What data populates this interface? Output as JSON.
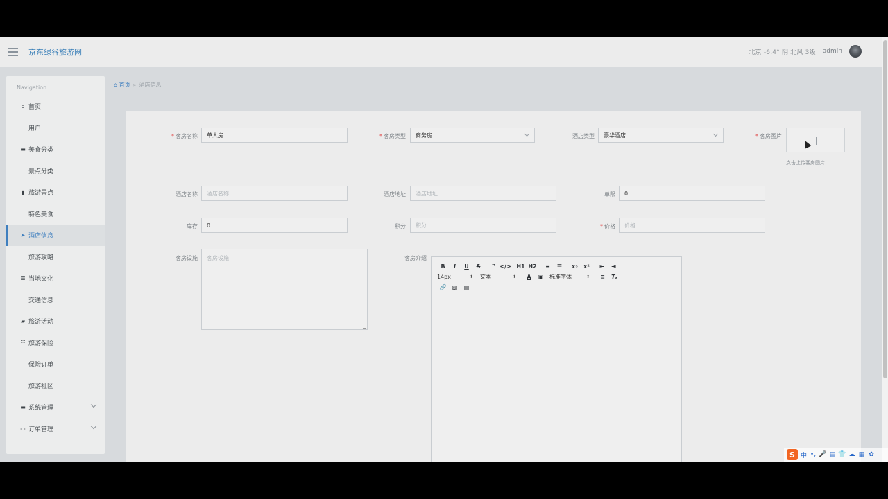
{
  "app": {
    "title": "京东绿谷旅游网"
  },
  "header": {
    "weather": "北京  -6.4°  阴  北风  3级",
    "user": "admin"
  },
  "sidebar": {
    "title": "Navigation",
    "items": [
      {
        "label": "首页",
        "icon": "home-icon"
      },
      {
        "label": "用户",
        "icon": "grid-icon"
      },
      {
        "label": "美食分类",
        "icon": "monitor-icon"
      },
      {
        "label": "景点分类",
        "icon": "grid-icon"
      },
      {
        "label": "旅游景点",
        "icon": "clipboard-icon"
      },
      {
        "label": "特色美食",
        "icon": "grid-icon"
      },
      {
        "label": "酒店信息",
        "icon": "send-icon",
        "active": true
      },
      {
        "label": "旅游攻略",
        "icon": "grid-icon"
      },
      {
        "label": "当地文化",
        "icon": "list-icon"
      },
      {
        "label": "交通信息",
        "icon": "grid-icon"
      },
      {
        "label": "旅游活动",
        "icon": "camera-icon"
      },
      {
        "label": "旅游保险",
        "icon": "sliders-icon"
      },
      {
        "label": "保险订单",
        "icon": "grid-icon"
      },
      {
        "label": "旅游社区",
        "icon": "grid-icon"
      },
      {
        "label": "系统管理",
        "icon": "monitor-icon",
        "expandable": true
      },
      {
        "label": "订单管理",
        "icon": "chat-icon",
        "expandable": true
      }
    ]
  },
  "breadcrumb": {
    "home": "首页",
    "separator": "»",
    "current": "酒店信息"
  },
  "form": {
    "room_name": {
      "label": "客房名称",
      "value": "单人房"
    },
    "room_type": {
      "label": "客房类型",
      "value": "商务房"
    },
    "hotel_type": {
      "label": "酒店类型",
      "value": "豪华酒店"
    },
    "room_image": {
      "label": "客房图片",
      "hint": "点击上传客房图片"
    },
    "hotel_name": {
      "label": "酒店名称",
      "placeholder": "酒店名称"
    },
    "hotel_address": {
      "label": "酒店地址",
      "placeholder": "酒店地址"
    },
    "limit": {
      "label": "单限",
      "value": "0"
    },
    "stock": {
      "label": "库存",
      "value": "0"
    },
    "points": {
      "label": "积分",
      "placeholder": "积分"
    },
    "price": {
      "label": "价格",
      "placeholder": "价格"
    },
    "facilities": {
      "label": "客房设施",
      "placeholder": "客房设施"
    },
    "intro": {
      "label": "客房介绍"
    }
  },
  "editor": {
    "row1": [
      "B",
      "I",
      "U",
      "S",
      "❞",
      "</>",
      "H1",
      "H2",
      "≡",
      "☰",
      "x₂",
      "x²",
      "⇤",
      "⇥"
    ],
    "size": "14px",
    "format": "文本",
    "font": "标准字体"
  },
  "taskbar": {
    "ime": "S",
    "lang": "中",
    "items": [
      "•,",
      "🎤",
      "▤",
      "👕",
      "☁",
      "▦",
      "✿"
    ]
  }
}
